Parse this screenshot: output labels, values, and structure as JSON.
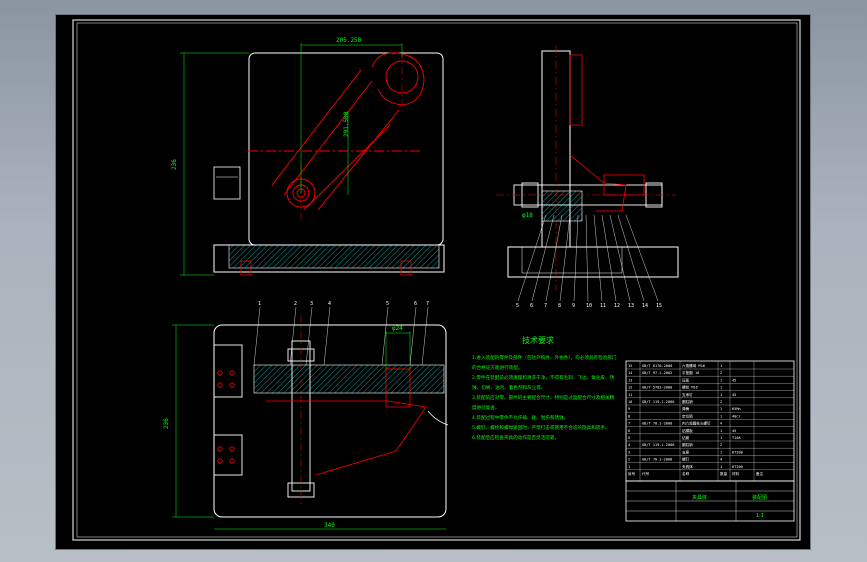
{
  "colors": {
    "background": "#000000",
    "outline": "#ffffff",
    "dimension": "#00ff00",
    "centerline": "#ff0000",
    "hatch": "#00ffff"
  },
  "front_view": {
    "dim_top": "205.250",
    "dim_height": "236",
    "dim_diag": "291.500"
  },
  "side_view": {
    "balloons": [
      "5",
      "6",
      "7",
      "8",
      "9",
      "10",
      "11",
      "12",
      "13",
      "14",
      "15"
    ],
    "dim_left": "φ18"
  },
  "top_view": {
    "balloons": [
      "1",
      "2",
      "3",
      "4",
      "5",
      "6",
      "7"
    ],
    "dim_width": "340",
    "dim_height": "236",
    "dim_small": "φ24"
  },
  "notes": {
    "title": "技术要求",
    "lines": [
      "1.进入装配的零件及部件（包括外购件、外协件），均必须具有检验部门",
      "的合格证方能进行装配。",
      "2.零件在装配前必须清理和清洗干净，不得有毛刺、飞边、氧化皮、锈",
      "蚀、切屑、油污、着色剂和灰尘等。",
      "3.装配前应对零、部件的主要配合尺寸，特别是过盈配合尺寸及相关精",
      "度进行复查。",
      "4.装配过程中零件不允许磕、碰、划伤和锈蚀。",
      "5.螺钉、螺栓和螺母紧固时，严禁打击或使用不合适的旋具和扳手。",
      "6.装配后应检查夹具的动作是否灵活可靠。"
    ]
  },
  "bom": {
    "rows": [
      [
        "15",
        "GB/T 6170-2000",
        "六角螺母 M16",
        "1",
        "",
        ""
      ],
      [
        "14",
        "GB/T 97.1-2002",
        "平垫圈 16",
        "2",
        "",
        ""
      ],
      [
        "13",
        "",
        "压板",
        "1",
        "45",
        ""
      ],
      [
        "12",
        "GB/T 5783-2000",
        "螺栓 M16",
        "1",
        "",
        ""
      ],
      [
        "11",
        "",
        "支承钉",
        "1",
        "45",
        ""
      ],
      [
        "10",
        "GB/T 119.1-2000",
        "圆柱销",
        "2",
        "",
        ""
      ],
      [
        "9",
        "",
        "弹簧",
        "1",
        "65Mn",
        ""
      ],
      [
        "8",
        "",
        "定位销",
        "1",
        "40Cr",
        ""
      ],
      [
        "7",
        "GB/T 70.1-2008",
        "内六角圆柱头螺钉",
        "4",
        "",
        ""
      ],
      [
        "6",
        "",
        "钻模板",
        "1",
        "45",
        ""
      ],
      [
        "5",
        "",
        "钻套",
        "1",
        "T10A",
        ""
      ],
      [
        "4",
        "GB/T 119.1-2000",
        "圆柱销",
        "2",
        "",
        ""
      ],
      [
        "3",
        "",
        "支座",
        "1",
        "HT200",
        ""
      ],
      [
        "2",
        "GB/T 70.1-2008",
        "螺钉",
        "4",
        "",
        ""
      ],
      [
        "1",
        "",
        "夹具体",
        "1",
        "HT200",
        ""
      ]
    ],
    "header": [
      "序号",
      "代号",
      "名称",
      "数量",
      "材料",
      "备注"
    ]
  },
  "title_block": {
    "title": "夹具体",
    "drawing_no": "装配图",
    "scale": "1:1"
  }
}
